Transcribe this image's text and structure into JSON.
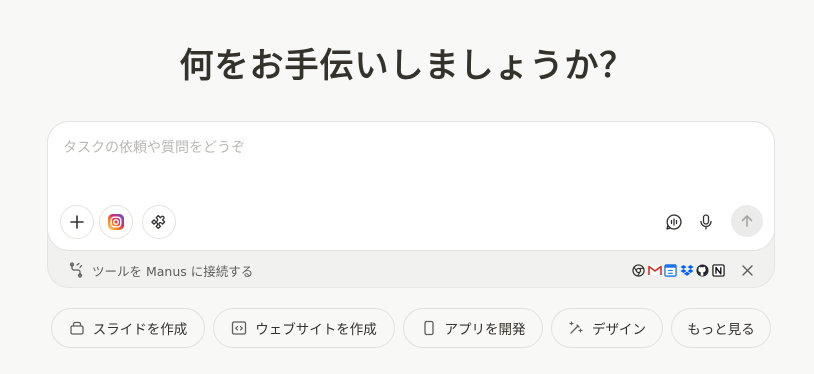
{
  "heading": "何をお手伝いしましょうか？",
  "composer": {
    "placeholder": "タスクの依頼や質問をどうぞ",
    "value": ""
  },
  "toolbar": {
    "add_icon": "plus-icon",
    "instagram_icon": "instagram-icon",
    "plugin_icon": "puzzle-icon",
    "voice_icon": "voice-waveform-icon",
    "mic_icon": "microphone-icon",
    "send_icon": "arrow-up-icon"
  },
  "connect_bar": {
    "label": "ツールを Manus に接続する",
    "apps": [
      "chrome-icon",
      "gmail-icon",
      "google-calendar-icon",
      "dropbox-icon",
      "github-icon",
      "notion-icon"
    ]
  },
  "quick_actions": [
    {
      "label": "スライドを作成",
      "icon": "slides-icon"
    },
    {
      "label": "ウェブサイトを作成",
      "icon": "code-window-icon"
    },
    {
      "label": "アプリを開発",
      "icon": "phone-icon"
    },
    {
      "label": "デザイン",
      "icon": "magic-wand-icon"
    },
    {
      "label": "もっと見る",
      "icon": ""
    }
  ],
  "colors": {
    "background": "#f8f8f7",
    "text": "#34322d",
    "placeholder": "#b9b8b4",
    "border": "#e4e3df",
    "send_button": "#ebebe9"
  }
}
